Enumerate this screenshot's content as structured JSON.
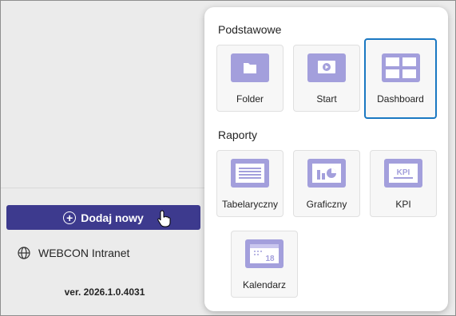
{
  "sidebar": {
    "add_button_label": "Dodaj nowy",
    "site_label": "WEBCON Intranet",
    "version": "ver. 2026.1.0.4031"
  },
  "panel": {
    "sections": [
      {
        "title": "Podstawowe",
        "tiles": [
          {
            "label": "Folder",
            "icon": "folder-icon"
          },
          {
            "label": "Start",
            "icon": "start-icon"
          },
          {
            "label": "Dashboard",
            "icon": "dashboard-icon",
            "selected": true
          }
        ]
      },
      {
        "title": "Raporty",
        "tiles": [
          {
            "label": "Tabelaryczny",
            "icon": "table-report-icon"
          },
          {
            "label": "Graficzny",
            "icon": "chart-report-icon"
          },
          {
            "label": "KPI",
            "icon": "kpi-icon"
          },
          {
            "label": "Kalendarz",
            "icon": "calendar-icon",
            "icon_text": "18"
          }
        ]
      }
    ]
  },
  "colors": {
    "accent": "#3d3a8e",
    "icon": "#a39fdc",
    "selected_border": "#1a78c2"
  }
}
